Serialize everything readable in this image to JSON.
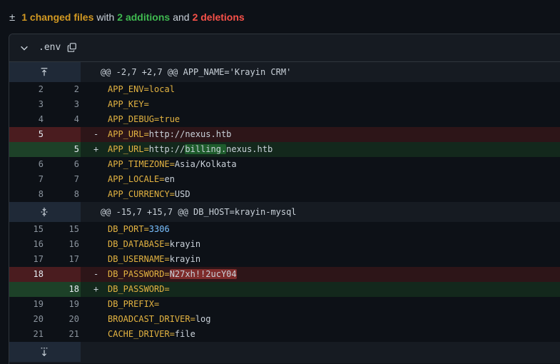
{
  "summary": {
    "prefix": "1 changed files",
    "with": "with",
    "additions": "2 additions",
    "and": "and",
    "deletions": "2 deletions"
  },
  "file": {
    "name": ".env"
  },
  "hunks": [
    {
      "header": "@@ -2,7 +2,7 @@ APP_NAME='Krayin CRM'"
    },
    {
      "header": "@@ -15,7 +15,7 @@ DB_HOST=krayin-mysql"
    }
  ],
  "lines_a": [
    {
      "old": "2",
      "new": "2",
      "sign": "",
      "key": "APP_ENV=",
      "val": "local",
      "type": "ctx",
      "valclass": "k"
    },
    {
      "old": "3",
      "new": "3",
      "sign": "",
      "key": "APP_KEY=",
      "val": "",
      "type": "ctx"
    },
    {
      "old": "4",
      "new": "4",
      "sign": "",
      "key": "APP_DEBUG=",
      "val": "true",
      "type": "ctx",
      "valclass": "k"
    },
    {
      "old": "5",
      "new": "",
      "sign": "-",
      "key": "APP_URL=",
      "val": "http://nexus.htb",
      "type": "del"
    },
    {
      "old": "",
      "new": "5",
      "sign": "+",
      "key": "APP_URL=",
      "val_pre": "http://",
      "val_hl": "billing.",
      "val_post": "nexus.htb",
      "type": "add"
    },
    {
      "old": "6",
      "new": "6",
      "sign": "",
      "key": "APP_TIMEZONE=",
      "val": "Asia/Kolkata",
      "type": "ctx"
    },
    {
      "old": "7",
      "new": "7",
      "sign": "",
      "key": "APP_LOCALE=",
      "val": "en",
      "type": "ctx"
    },
    {
      "old": "8",
      "new": "8",
      "sign": "",
      "key": "APP_CURRENCY=",
      "val": "USD",
      "type": "ctx"
    }
  ],
  "lines_b": [
    {
      "old": "15",
      "new": "15",
      "sign": "",
      "key": "DB_PORT=",
      "val": "3306",
      "type": "ctx",
      "valclass": "v-num"
    },
    {
      "old": "16",
      "new": "16",
      "sign": "",
      "key": "DB_DATABASE=",
      "val": "krayin",
      "type": "ctx"
    },
    {
      "old": "17",
      "new": "17",
      "sign": "",
      "key": "DB_USERNAME=",
      "val": "krayin",
      "type": "ctx"
    },
    {
      "old": "18",
      "new": "",
      "sign": "-",
      "key": "DB_PASSWORD=",
      "val_hl_red": "N27xh!!2ucY04",
      "type": "del"
    },
    {
      "old": "",
      "new": "18",
      "sign": "+",
      "key": "DB_PASSWORD=",
      "val": "",
      "type": "add"
    },
    {
      "old": "19",
      "new": "19",
      "sign": "",
      "key": "DB_PREFIX=",
      "val": "",
      "type": "ctx"
    },
    {
      "old": "20",
      "new": "20",
      "sign": "",
      "key": "BROADCAST_DRIVER=",
      "val": "log",
      "type": "ctx"
    },
    {
      "old": "21",
      "new": "21",
      "sign": "",
      "key": "CACHE_DRIVER=",
      "val": "file",
      "type": "ctx"
    }
  ],
  "colors": {
    "add": "#3fb950",
    "del": "#f85149",
    "changed": "#d29922"
  }
}
